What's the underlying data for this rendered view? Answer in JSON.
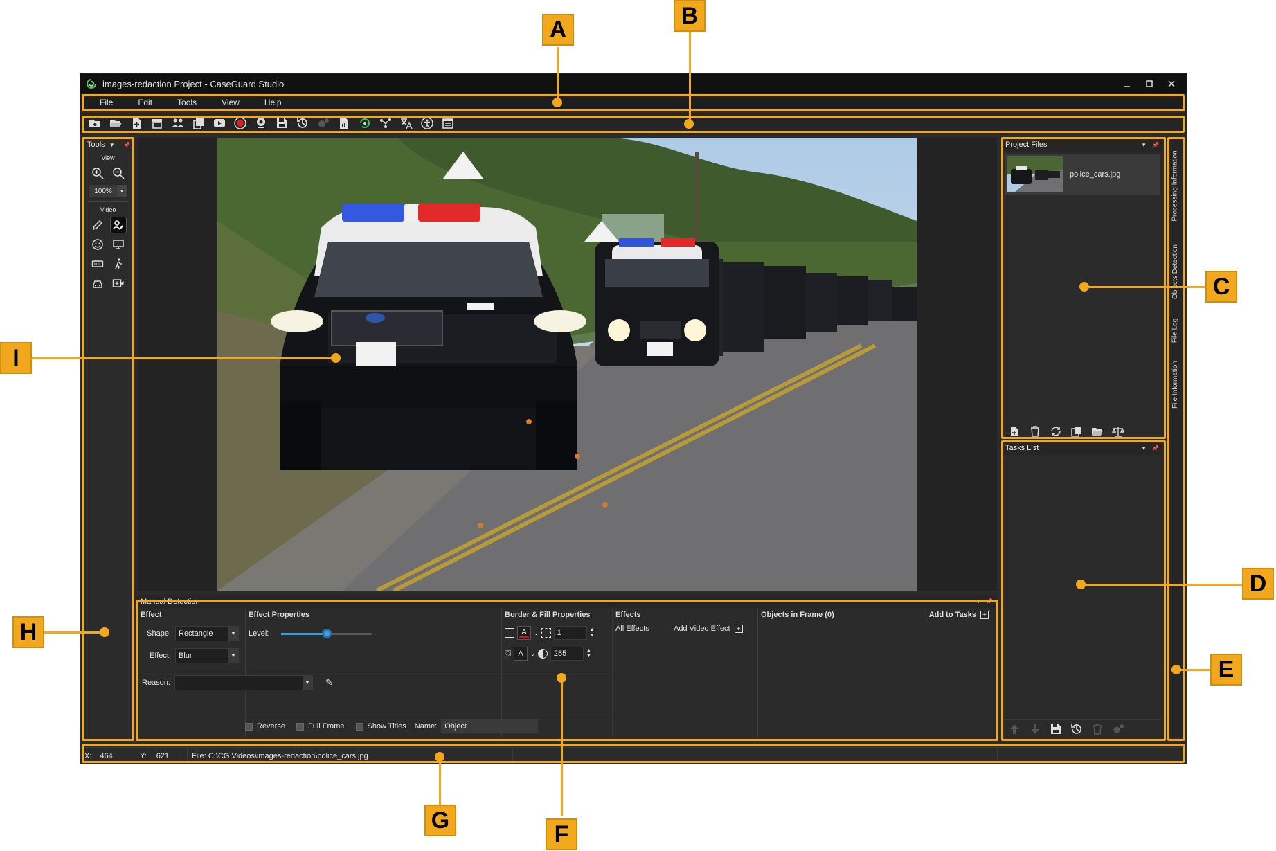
{
  "window": {
    "title": "images-redaction Project - CaseGuard Studio"
  },
  "menu": [
    "File",
    "Edit",
    "Tools",
    "View",
    "Help"
  ],
  "tools_panel": {
    "title": "Tools",
    "view_label": "View",
    "zoom": "100%",
    "video_label": "Video"
  },
  "project_files": {
    "title": "Project Files",
    "file_name": "police_cars.jpg"
  },
  "tasks_list": {
    "title": "Tasks List"
  },
  "side_tabs": [
    "Processing Information",
    "Objects Detection",
    "File Log",
    "File Information"
  ],
  "manual_detection": {
    "title": "Manual Detection",
    "effect": {
      "header": "Effect",
      "shape_label": "Shape:",
      "shape_value": "Rectangle",
      "effect_label": "Effect:",
      "effect_value": "Blur",
      "reason_label": "Reason:"
    },
    "effect_properties": {
      "header": "Effect Properties",
      "level_label": "Level:",
      "level_fraction": 0.5
    },
    "border_fill": {
      "header": "Border & Fill Properties",
      "border_width": "1",
      "opacity": "255",
      "border_color": "#c8102e"
    },
    "effects": {
      "header": "Effects",
      "all_effects": "All Effects",
      "add_video_effect": "Add Video Effect"
    },
    "objects": {
      "header": "Objects in Frame (0)",
      "add_to_tasks": "Add to Tasks"
    },
    "options": {
      "reverse": "Reverse",
      "full_frame": "Full Frame",
      "show_titles": "Show Titles",
      "name_label": "Name:",
      "name_value": "Object"
    }
  },
  "status": {
    "x_label": "X:",
    "x_value": "464",
    "y_label": "Y:",
    "y_value": "621",
    "file": "File: C:\\CG Videos\\images-redaction\\police_cars.jpg"
  },
  "annotations": [
    "A",
    "B",
    "C",
    "D",
    "E",
    "F",
    "G",
    "H",
    "I"
  ],
  "colors": {
    "accent": "#f2a81d",
    "background": "#2b2b2b",
    "slider": "#3aa0e0"
  }
}
